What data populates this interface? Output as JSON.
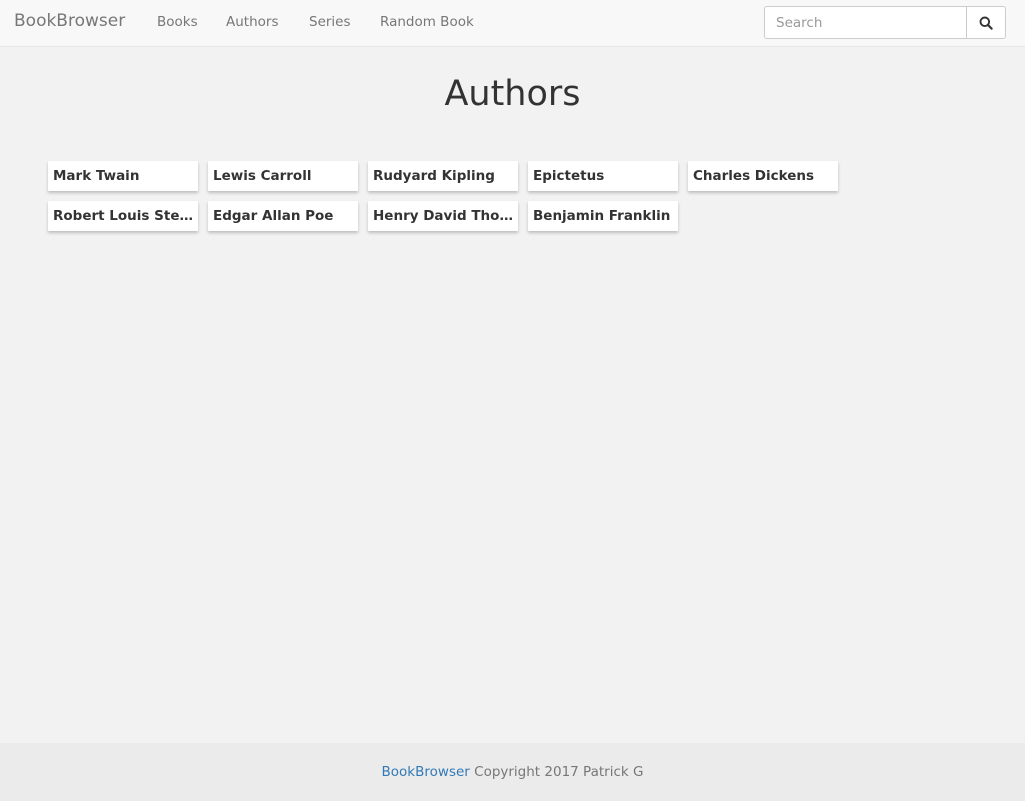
{
  "navbar": {
    "brand": "BookBrowser",
    "links": [
      "Books",
      "Authors",
      "Series",
      "Random Book"
    ],
    "search": {
      "placeholder": "Search",
      "value": ""
    }
  },
  "page": {
    "title": "Authors"
  },
  "authors": [
    "Mark Twain",
    "Lewis Carroll",
    "Rudyard Kipling",
    "Epictetus",
    "Charles Dickens",
    "Robert Louis Stevenson",
    "Edgar Allan Poe",
    "Henry David Thoreau",
    "Benjamin Franklin"
  ],
  "footer": {
    "link_text": "BookBrowser",
    "copyright": "Copyright 2017 Patrick G"
  },
  "icons": {
    "search_button": "search-icon"
  },
  "colors": {
    "link": "#337ab7",
    "navbar_bg": "#f8f8f8",
    "page_bg": "#f2f2f2"
  }
}
